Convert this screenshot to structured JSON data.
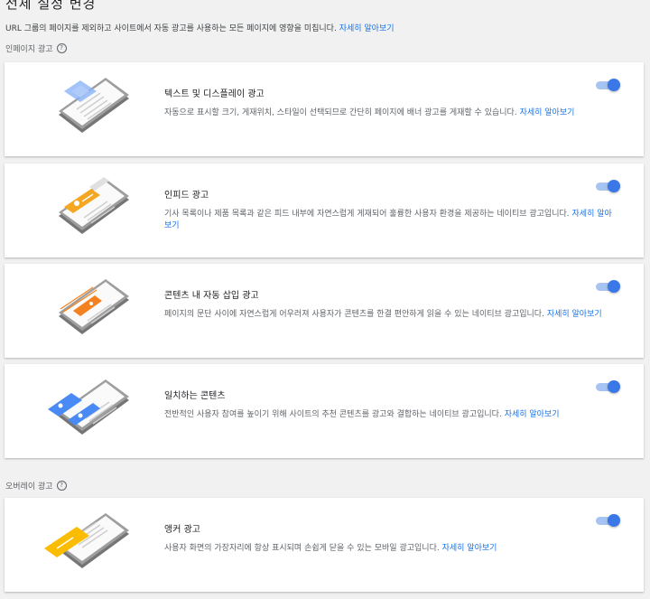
{
  "header": {
    "title": "전체 설정 변경",
    "subtitle": "URL 그룹의 페이지를 제외하고 사이트에서 자동 광고를 사용하는 모든 페이지에 영향을 미칩니다.",
    "learn_more": "자세히 알아보기"
  },
  "sections": {
    "inpage_label": "인페이지 광고",
    "overlay_label": "오버레이 광고",
    "help_glyph": "?"
  },
  "cards": [
    {
      "title": "텍스트 및 디스플레이 광고",
      "desc": "자동으로 표시할 크기, 게재위치, 스타일이 선택되므로 간단히 페이지에 배너 광고를 게재할 수 있습니다.",
      "link": "자세히 알아보기",
      "enabled": true,
      "accent": "#8ab4f8"
    },
    {
      "title": "인피드 광고",
      "desc": "기사 목록이나 제품 목록과 같은 피드 내부에 자연스럽게 게재되어 훌륭한 사용자 환경을 제공하는 네이티브 광고입니다.",
      "link": "자세히 알아보기",
      "enabled": true,
      "accent": "#f5a623"
    },
    {
      "title": "콘텐츠 내 자동 삽입 광고",
      "desc": "페이지의 문단 사이에 자연스럽게 어우러져 사용자가 콘텐츠를 한결 편안하게 읽을 수 있는 네이티브 광고입니다.",
      "link": "자세히 알아보기",
      "enabled": true,
      "accent": "#f4811f"
    },
    {
      "title": "일치하는 콘텐츠",
      "desc": "전반적인 사용자 참여를 높이기 위해 사이트의 추천 콘텐츠를 광고와 결합하는 네이티브 광고입니다.",
      "link": "자세히 알아보기",
      "enabled": true,
      "accent": "#4a8af4"
    },
    {
      "title": "앵커 광고",
      "desc": "사용자 화면의 가장자리에 항상 표시되며 손쉽게 닫을 수 있는 모바일 광고입니다.",
      "link": "자세히 알아보기",
      "enabled": true,
      "accent": "#fbbc04"
    }
  ],
  "colors": {
    "toggle_track": "#a7c3f2",
    "toggle_knob": "#3b78e7",
    "link": "#1a73e8"
  }
}
